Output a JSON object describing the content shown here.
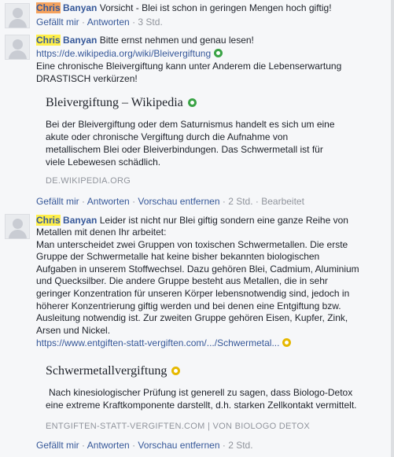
{
  "comments": [
    {
      "author_first": "Chris",
      "author_last": "Banyan",
      "text": "Vorsicht - Blei ist schon in geringen Mengen hoch giftig!",
      "actions": {
        "like": "Gefällt mir",
        "reply": "Antworten",
        "time": "3 Std."
      }
    },
    {
      "author_first": "Chris",
      "author_last": "Banyan",
      "text_line1": "Bitte ernst nehmen und genau lesen!",
      "link": "https://de.wikipedia.org/wiki/Bleivergiftung",
      "text_after_link": "Eine chronische Bleivergiftung kann unter Anderem die Lebenserwartung DRASTISCH verkürzen!",
      "preview": {
        "title": "Bleivergiftung – Wikipedia",
        "description": "Bei der Bleivergiftung oder dem Saturnismus handelt es sich um eine akute oder chronische Vergiftung durch die Aufnahme von metallischem Blei oder Bleiverbindungen. Das Schwermetall ist für viele Lebewesen schädlich.",
        "domain": "DE.WIKIPEDIA.ORG"
      },
      "actions": {
        "like": "Gefällt mir",
        "reply": "Antworten",
        "remove_preview": "Vorschau entfernen",
        "time": "2 Std.",
        "edited": "Bearbeitet"
      }
    },
    {
      "author_first": "Chris",
      "author_last": "Banyan",
      "text_line1": "Leider ist nicht nur Blei giftig sondern eine ganze Reihe von",
      "text_body": "Metallen mit denen Ihr arbeitet:\nMan unterscheidet zwei Gruppen von toxischen Schwermetallen. Die erste Gruppe der Schwermetalle hat keine bisher bekannten biologischen Aufgaben in unserem Stoffwechsel. Dazu gehören Blei, Cadmium, Aluminium und Quecksilber. Die andere Gruppe besteht aus Metallen, die in sehr geringer Konzentration für unseren Körper lebensnotwendig sind, jedoch in höherer Konzentrierung giftig werden und bei denen eine Entgiftung bzw. Ausleitung notwendig ist. Zur zweiten Gruppe gehören Eisen, Kupfer, Zink, Arsen und Nickel.",
      "link": "https://www.entgiften-statt-vergiften.com/.../Schwermetal...",
      "preview": {
        "title": "Schwermetallvergiftung",
        "description": "Nach kinesiologischer Prüfung ist generell zu sagen, dass Biologo-Detox eine extreme Kraftkomponente darstellt, d.h. starken Zellkontakt vermittelt.",
        "domain": "ENTGIFTEN-STATT-VERGIFTEN.COM",
        "source": "VON BIOLOGO DETOX"
      },
      "actions": {
        "like": "Gefällt mir",
        "reply": "Antworten",
        "remove_preview": "Vorschau entfernen",
        "time": "2 Std."
      }
    }
  ],
  "colors": {
    "link": "#365899",
    "highlight": "#ffef4a",
    "highlight_first": "#f5a25d",
    "meta": "#90949c",
    "green_dot": "#3aa346",
    "yellow_dot": "#e6b800"
  },
  "icons": {
    "avatar": "default-avatar-icon",
    "link_status_1": "green-circle-icon",
    "link_status_2": "yellow-circle-icon"
  }
}
